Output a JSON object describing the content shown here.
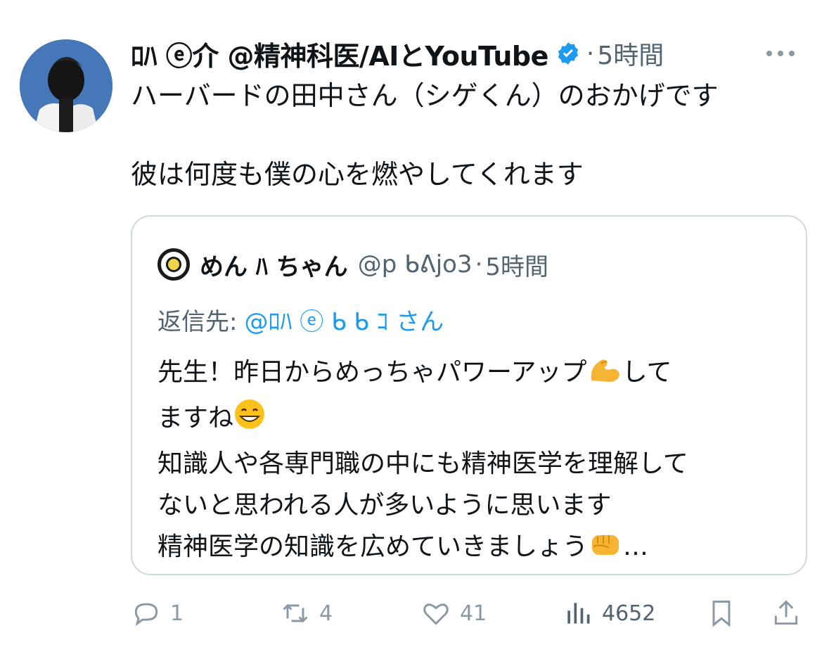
{
  "tweet": {
    "author_name": "ﾛﾊ ⓔ介 @精神科医/AIとYouTube",
    "dot": "·",
    "time": "5時間",
    "lines": [
      "ハーバードの田中さん（シゲくん）のおかげです",
      "",
      "彼は何度も僕の心を燃やしてくれます"
    ]
  },
  "quote": {
    "author_name": "めん ﾊ ちゃん",
    "handle": "@p ᑲᕕjo3",
    "dot": "·",
    "time": "5時間",
    "reply_label": "返信先:",
    "reply_mention": "@ﾛﾊ ⓔ ᑲ ᑲ ｺ さん",
    "lines": [
      "先生！昨日からめっちゃパワーアップ",
      "してますね",
      "知識人や各専門職の中にも精神医学を理解して",
      "ないと思われる人が多いように思います",
      "精神医学の知識を広めていきましょう",
      "…"
    ],
    "line1_tail": "して",
    "line2_head": "ますね"
  },
  "actions": {
    "replies": "1",
    "retweets": "4",
    "likes": "41",
    "views": "4652"
  },
  "icons": [
    "verified-icon",
    "more-icon",
    "reply-icon",
    "retweet-icon",
    "like-icon",
    "views-icon",
    "bookmark-icon",
    "share-icon",
    "muscle-emoji",
    "grin-emoji",
    "fist-emoji"
  ],
  "colors": {
    "accent": "#1d9bf0",
    "muted": "#536471",
    "border": "#cfd9de"
  }
}
